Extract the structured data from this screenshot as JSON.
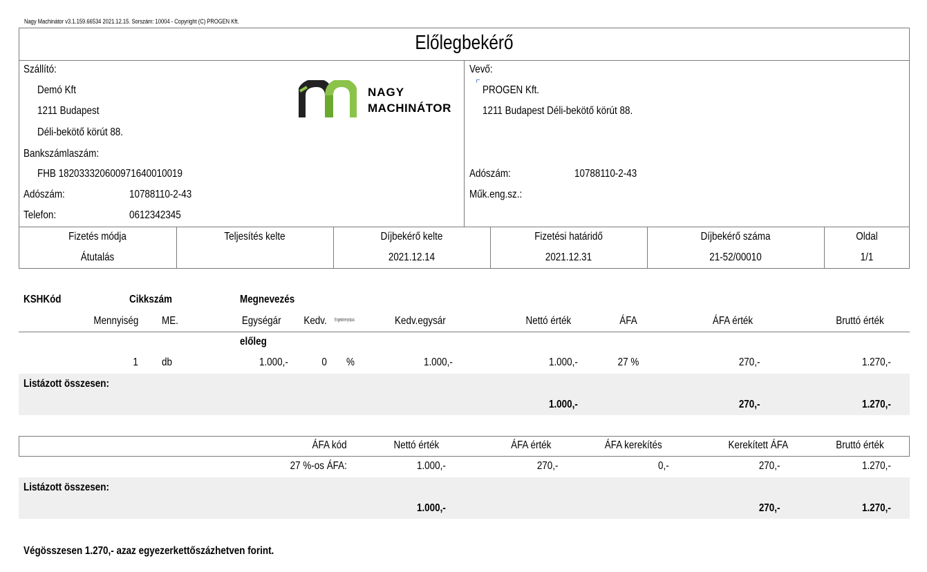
{
  "header_note": "Nagy Machinátor v3.1.159.66534 2021.12.15. Sorszám: 10004 - Copyright (C) PROGEN Kft.",
  "doc_title": "Előlegbekérő",
  "supplier": {
    "label": "Szállító:",
    "name": "Demó Kft",
    "city": "1211 Budapest",
    "street": "Déli-bekötő körút 88.",
    "bank_label": "Bankszámlaszám:",
    "bank_value": "FHB 18203332060097164001001​9",
    "tax_label": "Adószám:",
    "tax_value": "10788110-2-43",
    "phone_label": "Telefon:",
    "phone_value": "0612342345"
  },
  "logo": {
    "line1": "NAGY",
    "line2": "MACHINÁTOR"
  },
  "buyer": {
    "label": "Vevő:",
    "name": "PROGEN Kft.",
    "address": "1211 Budapest Déli-bekötő körút 88.",
    "tax_label": "Adószám:",
    "tax_value": "10788110-2-43",
    "reg_label": "Műk.eng.sz.:"
  },
  "info_row": [
    {
      "label": "Fizetés módja",
      "value": "Átutalás"
    },
    {
      "label": "Teljesítés kelte",
      "value": ""
    },
    {
      "label": "Díjbekérő kelte",
      "value": "2021.12.14"
    },
    {
      "label": "Fizetési határidő",
      "value": "2021.12.31"
    },
    {
      "label": "Díjbekérő száma",
      "value": "21-52/00010"
    },
    {
      "label": "Oldal",
      "value": "1/1"
    }
  ],
  "items_header": {
    "ksh": "KSHKód",
    "sku": "Cikkszám",
    "name": "Megnevezés",
    "qty": "Mennyiség",
    "unit": "ME.",
    "unit_price": "Egységár",
    "disc": "Kedv.",
    "disc_type": "Engedménytípus",
    "disc_price": "Kedv.egysár",
    "net": "Nettó érték",
    "vat": "ÁFA",
    "vat_value": "ÁFA érték",
    "gross": "Bruttó érték"
  },
  "items": [
    {
      "name": "előleg",
      "qty": "1",
      "unit": "db",
      "unit_price": "1.000,-",
      "disc": "0",
      "disc_type": "%",
      "disc_price": "1.000,-",
      "net": "1.000,-",
      "vat": "27 %",
      "vat_value": "270,-",
      "gross": "1.270,-"
    }
  ],
  "items_total": {
    "label": "Listázott összesen:",
    "net": "1.000,-",
    "vat_value": "270,-",
    "gross": "1.270,-"
  },
  "vat_header": {
    "code": "ÁFA kód",
    "net": "Nettó érték",
    "vat": "ÁFA érték",
    "rounding": "ÁFA kerekítés",
    "rounded": "Kerekített ÁFA",
    "gross": "Bruttó érték"
  },
  "vat_rows": [
    {
      "code": "27 %-os ÁFA:",
      "net": "1.000,-",
      "vat": "270,-",
      "rounding": "0,-",
      "rounded": "270,-",
      "gross": "1.270,-"
    }
  ],
  "vat_total": {
    "label": "Listázott összesen:",
    "net": "1.000,-",
    "rounded": "270,-",
    "gross": "1.270,-"
  },
  "grand_total": "Végösszesen 1.270,- azaz egyezerkettőszázhetven forint."
}
